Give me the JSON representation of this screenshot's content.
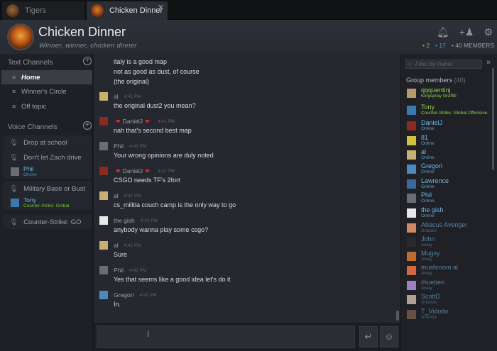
{
  "tabs": [
    {
      "label": "Tigers",
      "close": ""
    },
    {
      "label": "Chicken Dinner",
      "close": "✕"
    }
  ],
  "header": {
    "title": "Chicken Dinner",
    "subtitle": "Winner, winner, chicken dinner",
    "stats": {
      "ingame": "• 2",
      "online": "• 17",
      "members": "• 40 MEMBERS"
    },
    "icons": [
      "bell-icon",
      "add-friend-icon",
      "settings-icon"
    ]
  },
  "left": {
    "text_channels_label": "Text Channels",
    "text_channels": [
      "Home",
      "Winner's Circle",
      "Off topic"
    ],
    "voice_channels_label": "Voice Channels",
    "voice_channels": [
      {
        "name": "Drop at school",
        "users": []
      },
      {
        "name": "Don't let Zach drive",
        "users": [
          {
            "name": "Phil",
            "status": "Online"
          }
        ]
      },
      {
        "name": "Military Base or Bust",
        "users": [
          {
            "name": "Tony",
            "status": "Counter-Strike: Global"
          }
        ]
      },
      {
        "name": "Counter-Strike: GO",
        "users": []
      }
    ]
  },
  "chat": {
    "top_lines": [
      "italy is a good map",
      "not as good as dust, of course",
      "(the original)"
    ],
    "messages": [
      {
        "author": "al",
        "time": "4:41 PM",
        "text": "the original dust2 you mean?"
      },
      {
        "author": "DanielJ",
        "time": "4:41 PM",
        "text": "nah that's second best map"
      },
      {
        "author": "Phil",
        "time": "4:41 PM",
        "text": "Your wrong opinions are duly noted"
      },
      {
        "author": "DanielJ",
        "time": "4:41 PM",
        "text": "CSGO needs TF's 2fort"
      },
      {
        "author": "al",
        "time": "4:41 PM",
        "text": "cs_militia couch camp is the only way to go"
      },
      {
        "author": "the gish",
        "time": "4:42 PM",
        "text": "anybody wanna play some csgo?"
      },
      {
        "author": "al",
        "time": "4:42 PM",
        "text": "Sure"
      },
      {
        "author": "Phil",
        "time": "4:42 PM",
        "text": "Yes that seems like a good idea let's do it"
      },
      {
        "author": "Gregori",
        "time": "4:42 PM",
        "text": "In."
      }
    ]
  },
  "right": {
    "filter_placeholder": "Filter by Name",
    "group_members_label": "Group members",
    "group_members_count": "(40)",
    "members": [
      {
        "name": "qqquentinj",
        "status": "Kingspray Graffiti",
        "state": "ing"
      },
      {
        "name": "Tony",
        "status": "Counter-Strike: Global Offensive",
        "state": "ing"
      },
      {
        "name": "DanielJ",
        "status": "Online",
        "state": "on"
      },
      {
        "name": "81",
        "status": "Online",
        "state": "on"
      },
      {
        "name": "al",
        "status": "Online",
        "state": "on"
      },
      {
        "name": "Gregori",
        "status": "Online",
        "state": "on"
      },
      {
        "name": "Lawrence",
        "status": "Online",
        "state": "on"
      },
      {
        "name": "Phil",
        "status": "Online",
        "state": "on"
      },
      {
        "name": "the gish",
        "status": "Online",
        "state": "on"
      },
      {
        "name": "Abacus Avenger",
        "status": "Snooze",
        "state": "aw"
      },
      {
        "name": "John",
        "status": "Away",
        "state": "aw"
      },
      {
        "name": "Mugsy",
        "status": "Away",
        "state": "aw"
      },
      {
        "name": "mushroom al",
        "status": "Away",
        "state": "aw"
      },
      {
        "name": "rhueben",
        "status": "Away",
        "state": "aw"
      },
      {
        "name": "ScottD",
        "status": "Snooze",
        "state": "aw"
      },
      {
        "name": "T_Vidotto",
        "status": "Snooze",
        "state": "aw"
      }
    ]
  },
  "colors": {
    "ingame": "#8fd24a",
    "online": "#6fb8e8",
    "away": "#59809e",
    "heart": "#d42d2d"
  }
}
